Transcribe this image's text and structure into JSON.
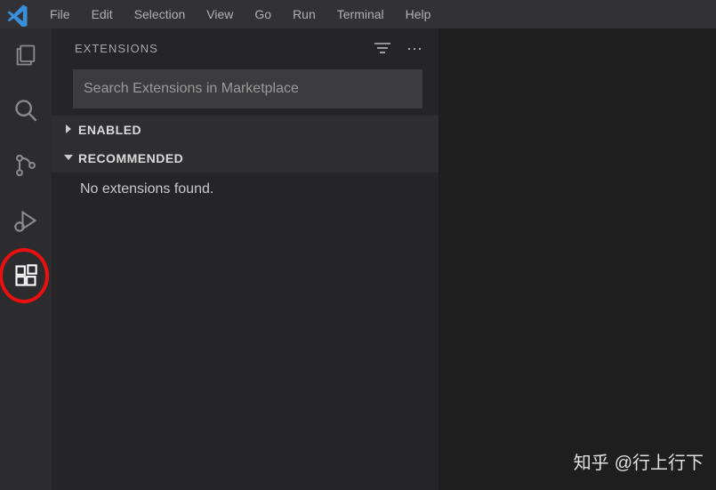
{
  "menu": {
    "items": [
      "File",
      "Edit",
      "Selection",
      "View",
      "Go",
      "Run",
      "Terminal",
      "Help"
    ]
  },
  "sidebar": {
    "title": "EXTENSIONS",
    "search_placeholder": "Search Extensions in Marketplace",
    "sections": {
      "enabled": "ENABLED",
      "recommended": "RECOMMENDED"
    },
    "empty_message": "No extensions found."
  },
  "watermark": {
    "brand": "知乎",
    "user": "@行上行下"
  }
}
